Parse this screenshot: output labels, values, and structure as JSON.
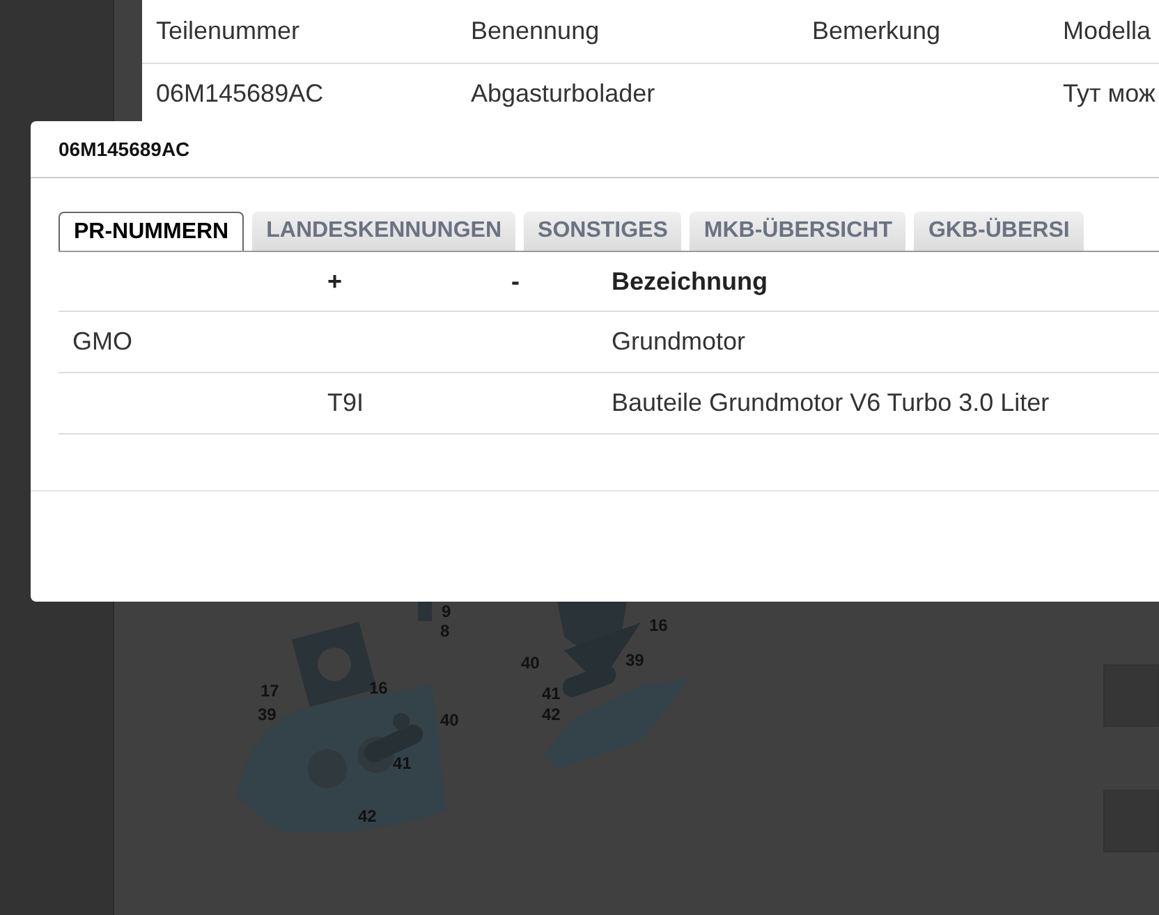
{
  "parts_table": {
    "columns": [
      "Teilenummer",
      "Benennung",
      "Bemerkung",
      "Modella"
    ],
    "rows": [
      [
        "06M145689AC",
        "Abgasturbolader",
        "",
        "Тут мож"
      ]
    ]
  },
  "diagram": {
    "callouts": [
      "9",
      "8",
      "16",
      "40",
      "39",
      "17",
      "16",
      "39",
      "41",
      "40",
      "42",
      "41",
      "42"
    ]
  },
  "modal": {
    "title": "06M145689AC",
    "tabs": [
      {
        "label": "PR-NUMMERN",
        "selected": true
      },
      {
        "label": "LANDESKENNUNGEN",
        "selected": false
      },
      {
        "label": "SONSTIGES",
        "selected": false
      },
      {
        "label": "MKB-ÜBERSICHT",
        "selected": false
      },
      {
        "label": "GKB-ÜBERSI",
        "selected": false
      }
    ],
    "table": {
      "columns": [
        "",
        "+",
        "-",
        "Bezeichnung"
      ],
      "rows": [
        [
          "GMO",
          "",
          "",
          "Grundmotor"
        ],
        [
          "",
          "T9I",
          "",
          "Bauteile Grundmotor V6 Turbo 3.0 Liter"
        ]
      ]
    }
  }
}
